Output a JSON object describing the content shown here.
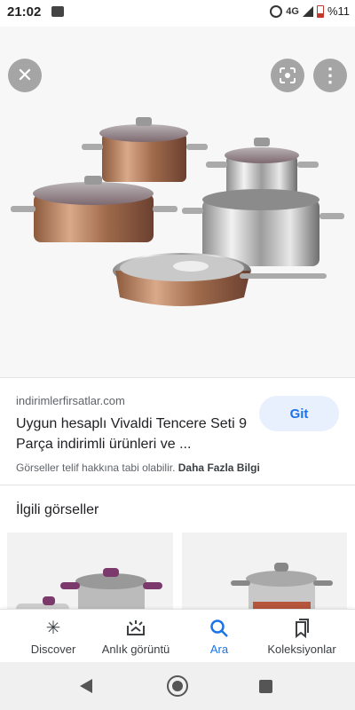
{
  "status_bar": {
    "time": "21:02",
    "network": "4G",
    "battery": "%11"
  },
  "viewer": {
    "close_icon": "close-icon",
    "lens_icon": "lens-icon",
    "more_icon": "more-vert-icon"
  },
  "result": {
    "source": "indirimlerfirsatlar.com",
    "title": "Uygun hesaplı Vivaldi Tencere Seti 9 Parça indirimli ürünleri ve ...",
    "visit_label": "Git",
    "copyright_text": "Görseller telif hakkına tabi olabilir.",
    "more_info_link": "Daha Fazla Bilgi"
  },
  "related": {
    "title": "İlgili görseller"
  },
  "bottom_nav": {
    "items": [
      {
        "label": "Discover",
        "icon": "asterisk-icon"
      },
      {
        "label": "Anlık görüntü",
        "icon": "snapshot-icon"
      },
      {
        "label": "Ara",
        "icon": "search-icon"
      },
      {
        "label": "Koleksiyonlar",
        "icon": "collections-icon"
      }
    ],
    "active": "Ara"
  },
  "colors": {
    "accent": "#1a73e8",
    "visit_bg": "#e8f0fe"
  }
}
